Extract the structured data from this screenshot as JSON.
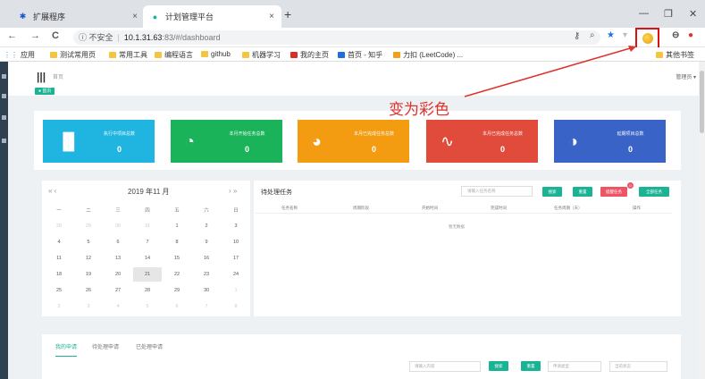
{
  "browser": {
    "tabs": [
      {
        "title": "扩展程序",
        "close": "×"
      },
      {
        "title": "计划管理平台",
        "close": "×"
      }
    ],
    "new_tab": "+",
    "window_controls": [
      "—",
      "❐",
      "✕"
    ],
    "nav": {
      "back": "←",
      "forward": "→",
      "reload": "C"
    },
    "url": {
      "security": "ⓘ 不安全",
      "host": "10.1.31.63",
      "path": ":83/#/dashboard"
    },
    "bookmarks": [
      "应用",
      "测试常用页",
      "常用工具",
      "编程语言",
      "github",
      "机器学习",
      "我的主页",
      "首页 - 知乎",
      "力扣 (LeetCode) ..."
    ],
    "other_bookmarks": "其他书签"
  },
  "app": {
    "breadcrumb": "首页",
    "page_tag": "● 首页",
    "user_menu": "管理员 ▾"
  },
  "annotation": {
    "text": "变为彩色"
  },
  "stats": [
    {
      "label": "执行中项目总数",
      "value": "0",
      "color": "#1fb5e0",
      "icon": "bar-chart-icon"
    },
    {
      "label": "本月开始任务总数",
      "value": "0",
      "color": "#1ab35a",
      "icon": "cycle-chart-icon"
    },
    {
      "label": "本月已完成任务总数",
      "value": "0",
      "color": "#f39c12",
      "icon": "pie-chart-icon"
    },
    {
      "label": "本月已完成任务总数",
      "value": "0",
      "color": "#e04b3c",
      "icon": "trend-chart-icon"
    },
    {
      "label": "延期项目总数",
      "value": "0",
      "color": "#3a63c7",
      "icon": "pie-icon"
    }
  ],
  "calendar": {
    "prev": "« ‹",
    "next": "› »",
    "title": "2019 年11 月",
    "weekdays": [
      "一",
      "二",
      "三",
      "四",
      "五",
      "六",
      "日"
    ],
    "weeks": [
      [
        "28",
        "29",
        "30",
        "31",
        "1",
        "2",
        "3"
      ],
      [
        "4",
        "5",
        "6",
        "7",
        "8",
        "9",
        "10"
      ],
      [
        "11",
        "12",
        "13",
        "14",
        "15",
        "16",
        "17"
      ],
      [
        "18",
        "19",
        "20",
        "21",
        "22",
        "23",
        "24"
      ],
      [
        "25",
        "26",
        "27",
        "28",
        "29",
        "30",
        "1"
      ],
      [
        "2",
        "3",
        "4",
        "5",
        "6",
        "7",
        "8"
      ]
    ],
    "today": "21"
  },
  "tasks": {
    "title": "待处理任务",
    "search_placeholder": "请输入任务名称",
    "buttons": [
      "搜索",
      "重置",
      "提醒任务",
      "全部任务"
    ],
    "badge": "0",
    "columns": [
      "任务名称",
      "周期阶段",
      "开始时间",
      "完成时间",
      "任务周期（天）",
      "操作"
    ],
    "empty": "暂无数据"
  },
  "requests": {
    "tabs": [
      "我的申请",
      "待处理申请",
      "已处理申请"
    ],
    "search_placeholder": "请输入内容",
    "buttons": [
      "搜索",
      "重置"
    ],
    "select1": "申请类型",
    "select2": "当前状态"
  },
  "colors": {
    "accent": "#1ab394",
    "sidebar": "#2f4050",
    "annotation": "#e0312b"
  }
}
